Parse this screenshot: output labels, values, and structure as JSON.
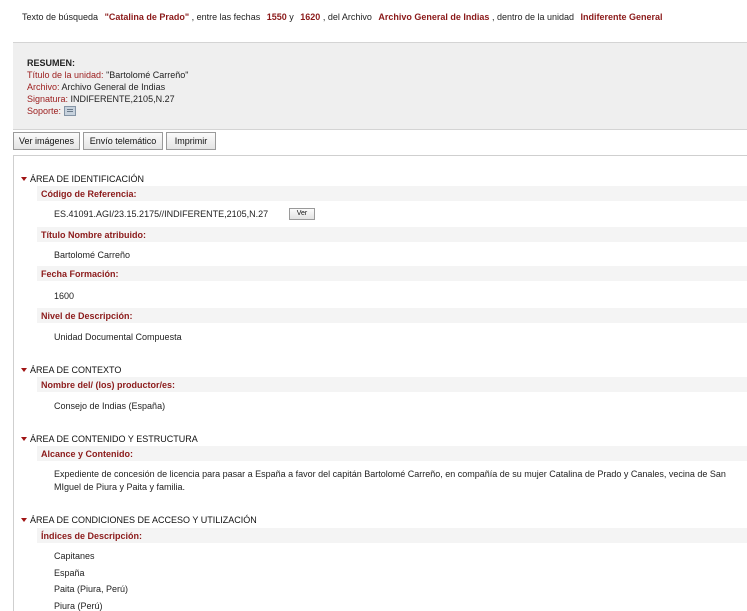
{
  "search": {
    "prefix": "Texto de búsqueda",
    "term": "\"Catalina de Prado\"",
    "between_text": ", entre las fechas",
    "date_from": "1550",
    "and_text": "y",
    "date_to": "1620",
    "archive_text": ", del Archivo",
    "archive": "Archivo General de Indias",
    "unit_text": ", dentro de la unidad",
    "unit": "Indiferente General"
  },
  "summary": {
    "title": "RESUMEN:",
    "unit_title_label": "Título de la unidad:",
    "unit_title_value": "\"Bartolomé Carreño\"",
    "archive_label": "Archivo:",
    "archive_value": "Archivo General de Indias",
    "signature_label": "Signatura:",
    "signature_value": "INDIFERENTE,2105,N.27",
    "support_label": "Soporte:",
    "support_icon": "document-icon"
  },
  "buttons": {
    "images": "Ver imágenes",
    "telematic": "Envío telemático",
    "print": "Imprimir"
  },
  "areas": {
    "identification": {
      "title": "ÁREA DE IDENTIFICACIÓN",
      "ref_label": "Código de Referencia:",
      "ref_value": "ES.41091.AGI/23.15.2175//INDIFERENTE,2105,N.27",
      "ref_button": "Ver",
      "title_label": "Título Nombre atribuido:",
      "title_value": "Bartolomé Carreño",
      "date_label": "Fecha Formación:",
      "date_value": "1600",
      "level_label": "Nivel de Descripción:",
      "level_value": "Unidad Documental Compuesta"
    },
    "context": {
      "title": "ÁREA DE CONTEXTO",
      "producer_label": "Nombre del/ (los) productor/es:",
      "producer_value": "Consejo de Indias (España)"
    },
    "content": {
      "title": "ÁREA DE CONTENIDO Y ESTRUCTURA",
      "scope_label": "Alcance y Contenido:",
      "scope_value": "Expediente de concesión de licencia para pasar a España a favor del capitán Bartolomé Carreño, en compañía de su mujer Catalina de Prado y Canales, vecina de San MIguel de Piura y Paita y familia."
    },
    "access": {
      "title": "ÁREA DE CONDICIONES DE ACCESO Y UTILIZACIÓN",
      "index_label": "Índices de Descripción:",
      "index_items": [
        "Capitanes",
        "España",
        "Paita (Piura, Perú)",
        "Piura (Perú)"
      ]
    }
  }
}
